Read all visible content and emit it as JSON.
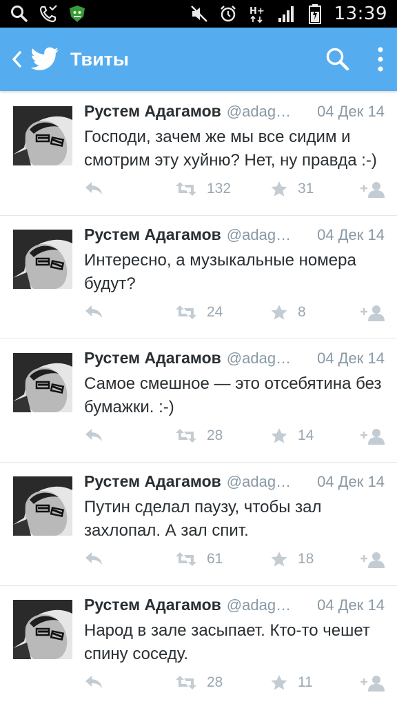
{
  "status_bar": {
    "time": "13:39",
    "icons": [
      "search-icon",
      "missed-call-icon",
      "shield-app-icon",
      "mute-icon",
      "alarm-icon",
      "hplus-data-icon",
      "signal-icon",
      "battery-icon"
    ]
  },
  "app_bar": {
    "title": "Твиты",
    "color": "#55acee",
    "icons": [
      "back-icon",
      "twitter-bird-icon",
      "search-icon",
      "overflow-menu-icon"
    ]
  },
  "tweets": [
    {
      "name": "Рустем Адагамов",
      "handle": "@adaga…",
      "date": "04 Дек 14",
      "text": "Господи, зачем же мы все сидим и смотрим эту хуйню? Нет, ну правда :-)",
      "retweets": "132",
      "favorites": "31"
    },
    {
      "name": "Рустем Адагамов",
      "handle": "@adaga…",
      "date": "04 Дек 14",
      "text": "Интересно, а музыкальные номера будут?",
      "retweets": "24",
      "favorites": "8"
    },
    {
      "name": "Рустем Адагамов",
      "handle": "@adaga…",
      "date": "04 Дек 14",
      "text": "Самое смешное — это отсебятина без бумажки. :-)",
      "retweets": "28",
      "favorites": "14"
    },
    {
      "name": "Рустем Адагамов",
      "handle": "@adaga…",
      "date": "04 Дек 14",
      "text": "Путин сделал паузу, чтобы зал захлопал. А зал спит.",
      "retweets": "61",
      "favorites": "18"
    },
    {
      "name": "Рустем Адагамов",
      "handle": "@adaga…",
      "date": "04 Дек 14",
      "text": "Народ в зале засыпает. Кто-то чешет спину соседу.",
      "retweets": "28",
      "favorites": "11"
    }
  ]
}
